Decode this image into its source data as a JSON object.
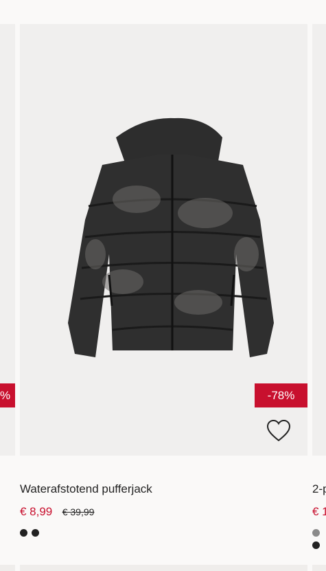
{
  "products": {
    "left": {
      "discount_badge": "%"
    },
    "main": {
      "discount_badge": "-78%",
      "title": "Waterafstotend pufferjack",
      "sale_price": "€ 8,99",
      "original_price": "€ 39,99",
      "swatches": [
        "#222222",
        "#222222"
      ]
    },
    "right": {
      "title": "2-p",
      "sale_price": "€ 1",
      "swatches": [
        "#8a8a8a",
        "#222222"
      ]
    }
  },
  "colors": {
    "sale": "#c8102e",
    "text": "#222222",
    "image_bg": "#f0efee"
  },
  "icons": {
    "favorite": "heart-outline-icon"
  }
}
